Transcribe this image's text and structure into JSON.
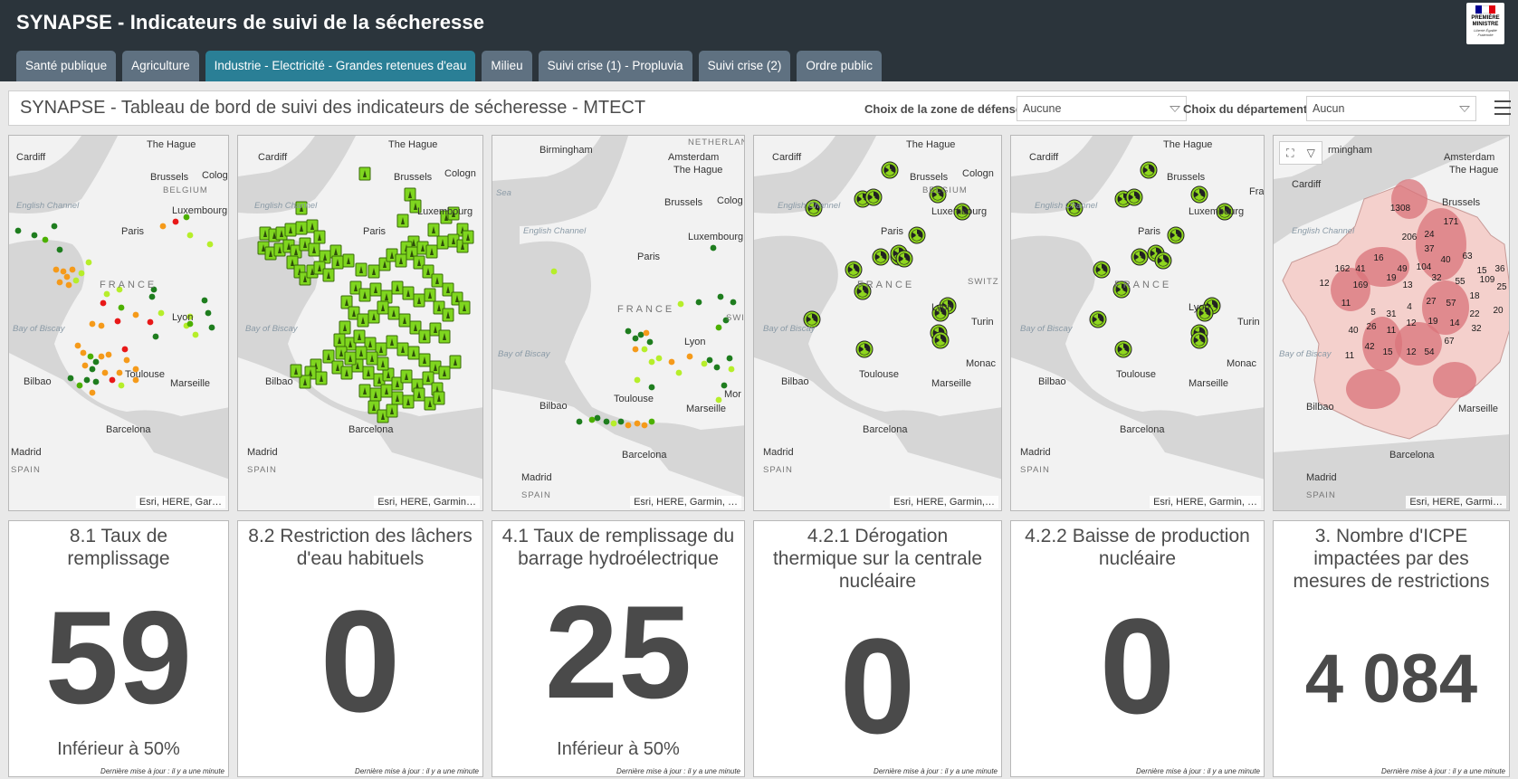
{
  "header": {
    "title": "SYNAPSE - Indicateurs de suivi de la sécheresse",
    "logo": {
      "line1": "PREMIÈRE",
      "line2": "MINISTRE",
      "motto": "Liberté Égalité Fraternité",
      "flag_colors": [
        "#000091",
        "#ffffff",
        "#e1000f"
      ]
    }
  },
  "tabs": [
    {
      "label": "Santé publique",
      "active": false
    },
    {
      "label": "Agriculture",
      "active": false
    },
    {
      "label": "Industrie - Electricité - Grandes retenues d'eau",
      "active": true
    },
    {
      "label": "Milieu",
      "active": false
    },
    {
      "label": "Suivi crise (1) - Propluvia",
      "active": false
    },
    {
      "label": "Suivi crise (2)",
      "active": false
    },
    {
      "label": "Ordre public",
      "active": false
    }
  ],
  "toolbar": {
    "title": "SYNAPSE - Tableau de bord de suivi des indicateurs de sécheresse - MTECT",
    "zone_label": "Choix de la zone de défense",
    "zone_value": "Aucune",
    "dept_label": "Choix du département",
    "dept_value": "Aucun",
    "menu_icon": "hamburger-menu-icon"
  },
  "maps": [
    {
      "attribution": "Esri, HERE, Gar…"
    },
    {
      "attribution": "Esri, HERE, Garmin…"
    },
    {
      "attribution": "Esri, HERE, Garmin, …"
    },
    {
      "attribution": "Esri, HERE, Garmin,…"
    },
    {
      "attribution": "Esri, HERE, Garmin, …"
    },
    {
      "attribution": "Esri, HERE, Garmi…",
      "tools": "zoom-select-icon"
    }
  ],
  "map_labels": {
    "cardiff": "Cardiff",
    "the_hague": "The Hague",
    "brussels": "Brussels",
    "belgium": "BELGIUM",
    "cologne": "Cologn",
    "luxembourg": "Luxembourg",
    "paris": "Paris",
    "france": "FRANCE",
    "lyon": "Lyon",
    "toulouse": "Toulouse",
    "marseille": "Marseille",
    "bilbao": "Bilbao",
    "barcelona": "Barcelona",
    "madrid": "Madrid",
    "spain": "SPAIN",
    "bay_of_biscay": "Bay of Biscay",
    "english_channel": "English Channel",
    "birmingham": "Birmingham",
    "amsterdam": "Amsterdam",
    "netherlands": "NETHERLANDS",
    "monaco": "Monaco",
    "turin": "Turin",
    "switz": "SWITZ",
    "sea": "Sea",
    "birmingham_cut": "rmingham",
    "fra": "Fra",
    "mor": "Mor",
    "cologne_cut": "Cologne",
    "luxembourg_cut": "Luxembourg",
    "sw": "SWI",
    "cologne2": "Colog",
    "mon": "Monac"
  },
  "legend_colors": {
    "dark_green": "#1e7d1e",
    "green": "#4cb000",
    "light_green": "#b6ee2a",
    "orange": "#f59a1a",
    "red": "#e81818",
    "nuclear": "#8fd61e",
    "dam": "#7fd61f",
    "choropleth_light": "#f4d0cc",
    "choropleth_dark": "#d9737a"
  },
  "choropleth_values": [
    "1308",
    "206",
    "24",
    "171",
    "37",
    "16",
    "49",
    "104",
    "40",
    "63",
    "15",
    "169",
    "19",
    "13",
    "32",
    "55",
    "109",
    "36",
    "12",
    "162",
    "41",
    "22",
    "11",
    "5",
    "31",
    "4",
    "27",
    "57",
    "18",
    "25",
    "40",
    "26",
    "11",
    "12",
    "19",
    "14",
    "32",
    "20",
    "11",
    "42",
    "15",
    "12",
    "54",
    "67"
  ],
  "cards": [
    {
      "title": "8.1 Taux de remplissage",
      "value": "59",
      "sub": "Inférieur à 50%",
      "update": "Dernière mise à jour : il y a une minute"
    },
    {
      "title": "8.2 Restriction des lâchers d'eau habituels",
      "value": "0",
      "sub": "",
      "update": "Dernière mise à jour : il y a une minute"
    },
    {
      "title": "4.1 Taux de remplissage du barrage hydroélectrique",
      "value": "25",
      "sub": "Inférieur à 50%",
      "update": "Dernière mise à jour : il y a une minute"
    },
    {
      "title": "4.2.1 Dérogation thermique sur la centrale nucléaire",
      "value": "0",
      "sub": "",
      "update": "Dernière mise à jour : il y a une minute"
    },
    {
      "title": "4.2.2 Baisse de production nucléaire",
      "value": "0",
      "sub": "",
      "update": "Dernière mise à jour : il y a une minute"
    },
    {
      "title": "3. Nombre d'ICPE impactées par des mesures de restrictions",
      "value": "4 084",
      "sub": "",
      "update": "Dernière mise à jour : il y a une minute"
    }
  ]
}
